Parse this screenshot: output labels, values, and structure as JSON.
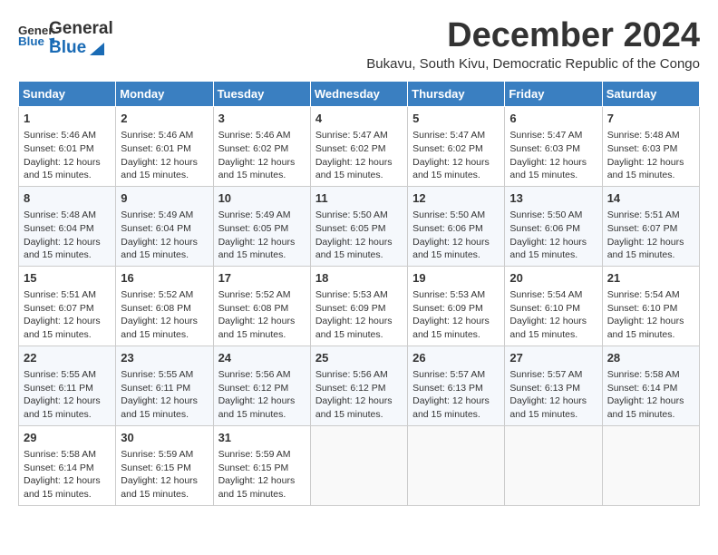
{
  "header": {
    "logo_general": "General",
    "logo_blue": "Blue",
    "month_title": "December 2024",
    "location": "Bukavu, South Kivu, Democratic Republic of the Congo"
  },
  "weekdays": [
    "Sunday",
    "Monday",
    "Tuesday",
    "Wednesday",
    "Thursday",
    "Friday",
    "Saturday"
  ],
  "weeks": [
    [
      {
        "day": "1",
        "sunrise": "5:46 AM",
        "sunset": "6:01 PM",
        "daylight": "12 hours and 15 minutes."
      },
      {
        "day": "2",
        "sunrise": "5:46 AM",
        "sunset": "6:01 PM",
        "daylight": "12 hours and 15 minutes."
      },
      {
        "day": "3",
        "sunrise": "5:46 AM",
        "sunset": "6:02 PM",
        "daylight": "12 hours and 15 minutes."
      },
      {
        "day": "4",
        "sunrise": "5:47 AM",
        "sunset": "6:02 PM",
        "daylight": "12 hours and 15 minutes."
      },
      {
        "day": "5",
        "sunrise": "5:47 AM",
        "sunset": "6:02 PM",
        "daylight": "12 hours and 15 minutes."
      },
      {
        "day": "6",
        "sunrise": "5:47 AM",
        "sunset": "6:03 PM",
        "daylight": "12 hours and 15 minutes."
      },
      {
        "day": "7",
        "sunrise": "5:48 AM",
        "sunset": "6:03 PM",
        "daylight": "12 hours and 15 minutes."
      }
    ],
    [
      {
        "day": "8",
        "sunrise": "5:48 AM",
        "sunset": "6:04 PM",
        "daylight": "12 hours and 15 minutes."
      },
      {
        "day": "9",
        "sunrise": "5:49 AM",
        "sunset": "6:04 PM",
        "daylight": "12 hours and 15 minutes."
      },
      {
        "day": "10",
        "sunrise": "5:49 AM",
        "sunset": "6:05 PM",
        "daylight": "12 hours and 15 minutes."
      },
      {
        "day": "11",
        "sunrise": "5:50 AM",
        "sunset": "6:05 PM",
        "daylight": "12 hours and 15 minutes."
      },
      {
        "day": "12",
        "sunrise": "5:50 AM",
        "sunset": "6:06 PM",
        "daylight": "12 hours and 15 minutes."
      },
      {
        "day": "13",
        "sunrise": "5:50 AM",
        "sunset": "6:06 PM",
        "daylight": "12 hours and 15 minutes."
      },
      {
        "day": "14",
        "sunrise": "5:51 AM",
        "sunset": "6:07 PM",
        "daylight": "12 hours and 15 minutes."
      }
    ],
    [
      {
        "day": "15",
        "sunrise": "5:51 AM",
        "sunset": "6:07 PM",
        "daylight": "12 hours and 15 minutes."
      },
      {
        "day": "16",
        "sunrise": "5:52 AM",
        "sunset": "6:08 PM",
        "daylight": "12 hours and 15 minutes."
      },
      {
        "day": "17",
        "sunrise": "5:52 AM",
        "sunset": "6:08 PM",
        "daylight": "12 hours and 15 minutes."
      },
      {
        "day": "18",
        "sunrise": "5:53 AM",
        "sunset": "6:09 PM",
        "daylight": "12 hours and 15 minutes."
      },
      {
        "day": "19",
        "sunrise": "5:53 AM",
        "sunset": "6:09 PM",
        "daylight": "12 hours and 15 minutes."
      },
      {
        "day": "20",
        "sunrise": "5:54 AM",
        "sunset": "6:10 PM",
        "daylight": "12 hours and 15 minutes."
      },
      {
        "day": "21",
        "sunrise": "5:54 AM",
        "sunset": "6:10 PM",
        "daylight": "12 hours and 15 minutes."
      }
    ],
    [
      {
        "day": "22",
        "sunrise": "5:55 AM",
        "sunset": "6:11 PM",
        "daylight": "12 hours and 15 minutes."
      },
      {
        "day": "23",
        "sunrise": "5:55 AM",
        "sunset": "6:11 PM",
        "daylight": "12 hours and 15 minutes."
      },
      {
        "day": "24",
        "sunrise": "5:56 AM",
        "sunset": "6:12 PM",
        "daylight": "12 hours and 15 minutes."
      },
      {
        "day": "25",
        "sunrise": "5:56 AM",
        "sunset": "6:12 PM",
        "daylight": "12 hours and 15 minutes."
      },
      {
        "day": "26",
        "sunrise": "5:57 AM",
        "sunset": "6:13 PM",
        "daylight": "12 hours and 15 minutes."
      },
      {
        "day": "27",
        "sunrise": "5:57 AM",
        "sunset": "6:13 PM",
        "daylight": "12 hours and 15 minutes."
      },
      {
        "day": "28",
        "sunrise": "5:58 AM",
        "sunset": "6:14 PM",
        "daylight": "12 hours and 15 minutes."
      }
    ],
    [
      {
        "day": "29",
        "sunrise": "5:58 AM",
        "sunset": "6:14 PM",
        "daylight": "12 hours and 15 minutes."
      },
      {
        "day": "30",
        "sunrise": "5:59 AM",
        "sunset": "6:15 PM",
        "daylight": "12 hours and 15 minutes."
      },
      {
        "day": "31",
        "sunrise": "5:59 AM",
        "sunset": "6:15 PM",
        "daylight": "12 hours and 15 minutes."
      },
      {
        "day": "",
        "sunrise": "",
        "sunset": "",
        "daylight": ""
      },
      {
        "day": "",
        "sunrise": "",
        "sunset": "",
        "daylight": ""
      },
      {
        "day": "",
        "sunrise": "",
        "sunset": "",
        "daylight": ""
      },
      {
        "day": "",
        "sunrise": "",
        "sunset": "",
        "daylight": ""
      }
    ]
  ],
  "labels": {
    "sunrise": "Sunrise:",
    "sunset": "Sunset:",
    "daylight": "Daylight:"
  }
}
